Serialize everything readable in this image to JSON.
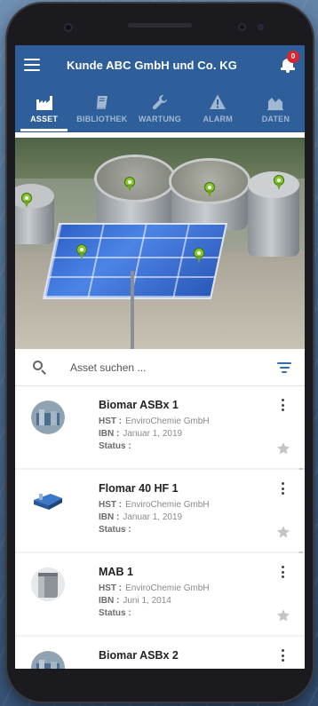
{
  "app": {
    "title": "Kunde ABC GmbH und Co. KG",
    "notification_count": "0"
  },
  "tabs": [
    {
      "label": "ASSET",
      "icon": "factory-icon",
      "active": true
    },
    {
      "label": "BIBLIOTHEK",
      "icon": "book-icon",
      "active": false
    },
    {
      "label": "WARTUNG",
      "icon": "wrench-icon",
      "active": false
    },
    {
      "label": "ALARM",
      "icon": "warning-icon",
      "active": false
    },
    {
      "label": "DATEN",
      "icon": "chart-area-icon",
      "active": false
    }
  ],
  "search": {
    "placeholder": "Asset suchen ..."
  },
  "labels": {
    "hst": "HST :",
    "ibn": "IBN :",
    "status": "Status :"
  },
  "assets": [
    {
      "name": "Biomar ASBx 1",
      "hst": "EnviroChemie GmbH",
      "ibn": "Januar 1, 2019",
      "status": ""
    },
    {
      "name": "Flomar 40 HF 1",
      "hst": "EnviroChemie GmbH",
      "ibn": "Januar 1, 2019",
      "status": ""
    },
    {
      "name": "MAB 1",
      "hst": "EnviroChemie GmbH",
      "ibn": "Juni 1, 2014",
      "status": ""
    },
    {
      "name": "Biomar ASBx 2",
      "hst": "",
      "ibn": "",
      "status": ""
    }
  ],
  "colors": {
    "primary": "#2f5f9a",
    "badge": "#d9262c",
    "pin": "#86c92f",
    "filter": "#2f6fb0"
  }
}
